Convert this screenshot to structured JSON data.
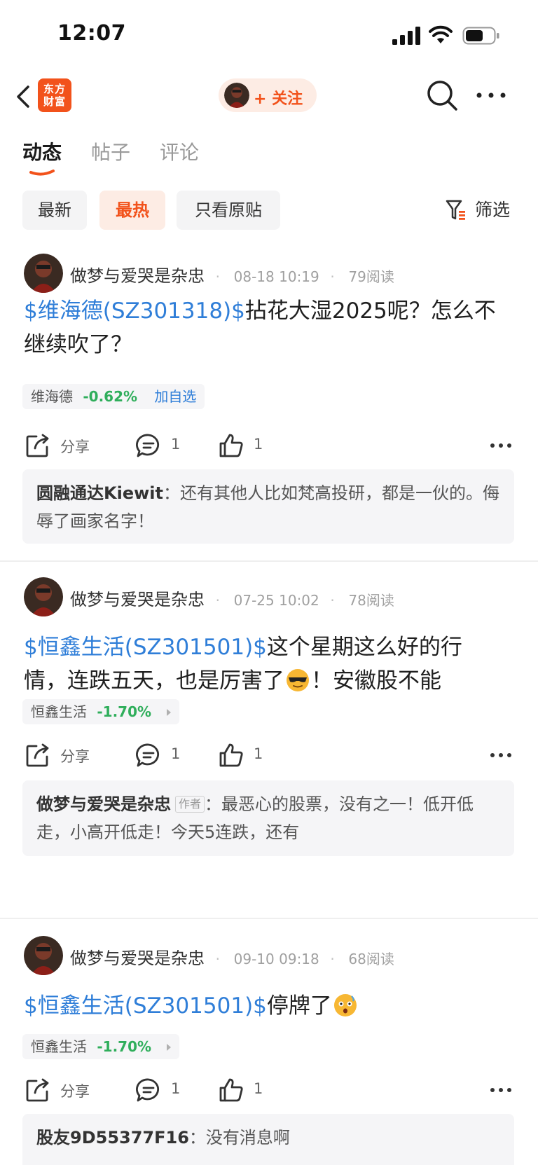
{
  "status_bar": {
    "time": "12:07"
  },
  "nav": {
    "logo_line1": "东方",
    "logo_line2": "财富",
    "follow_label": "+ 关注"
  },
  "tabs": [
    {
      "label": "动态",
      "active": true
    },
    {
      "label": "帖子",
      "active": false
    },
    {
      "label": "评论",
      "active": false
    }
  ],
  "filters": {
    "chips": [
      {
        "label": "最新",
        "active": false
      },
      {
        "label": "最热",
        "active": true
      },
      {
        "label": "只看原贴",
        "active": false
      }
    ],
    "filter_label": "筛选"
  },
  "colors": {
    "accent": "#f2521b",
    "link": "#2f7ed8",
    "stock_down": "#2fae5b"
  },
  "posts": [
    {
      "author": "做梦与爱哭是杂忠",
      "time": "08-18 10:19",
      "reads": "79阅读",
      "stock_tag": "$维海德(SZ301318)$",
      "text": "拈花大湿2025呢？怎么不继续吹了？",
      "stock_card": {
        "name": "维海德",
        "change": "-0.62%",
        "add_label": "加自选"
      },
      "share_label": "分享",
      "comment_count": "1",
      "like_count": "1",
      "comment": {
        "user": "圆融通达Kiewit",
        "sep": "：",
        "text": "还有其他人比如梵高投研，都是一伙的。侮辱了画家名字！"
      }
    },
    {
      "author": "做梦与爱哭是杂忠",
      "time": "07-25 10:02",
      "reads": "78阅读",
      "stock_tag": "$恒鑫生活(SZ301501)$",
      "text_before": "这个星期这么好的行情，连跌五天，也是厉害了",
      "emoji": "sunglasses-emoji",
      "text_after": "！安徽股不能买，记住了",
      "stock_card": {
        "name": "恒鑫生活",
        "change": "-1.70%"
      },
      "share_label": "分享",
      "comment_count": "1",
      "like_count": "1",
      "comment": {
        "user": "做梦与爱哭是杂忠",
        "tag": "作者",
        "sep": "：",
        "text": "最恶心的股票，没有之一！低开低走，小高开低走！今天5连跌，还有"
      }
    },
    {
      "author": "做梦与爱哭是杂忠",
      "time": "09-10 09:18",
      "reads": "68阅读",
      "stock_tag": "$恒鑫生活(SZ301501)$",
      "text": "停牌了",
      "emoji": "surprised-emoji",
      "stock_card": {
        "name": "恒鑫生活",
        "change": "-1.70%"
      },
      "share_label": "分享",
      "comment_count": "1",
      "like_count": "1",
      "comment": {
        "user": "股友9D55377F16",
        "sep": "：",
        "text": "没有消息啊"
      }
    }
  ]
}
